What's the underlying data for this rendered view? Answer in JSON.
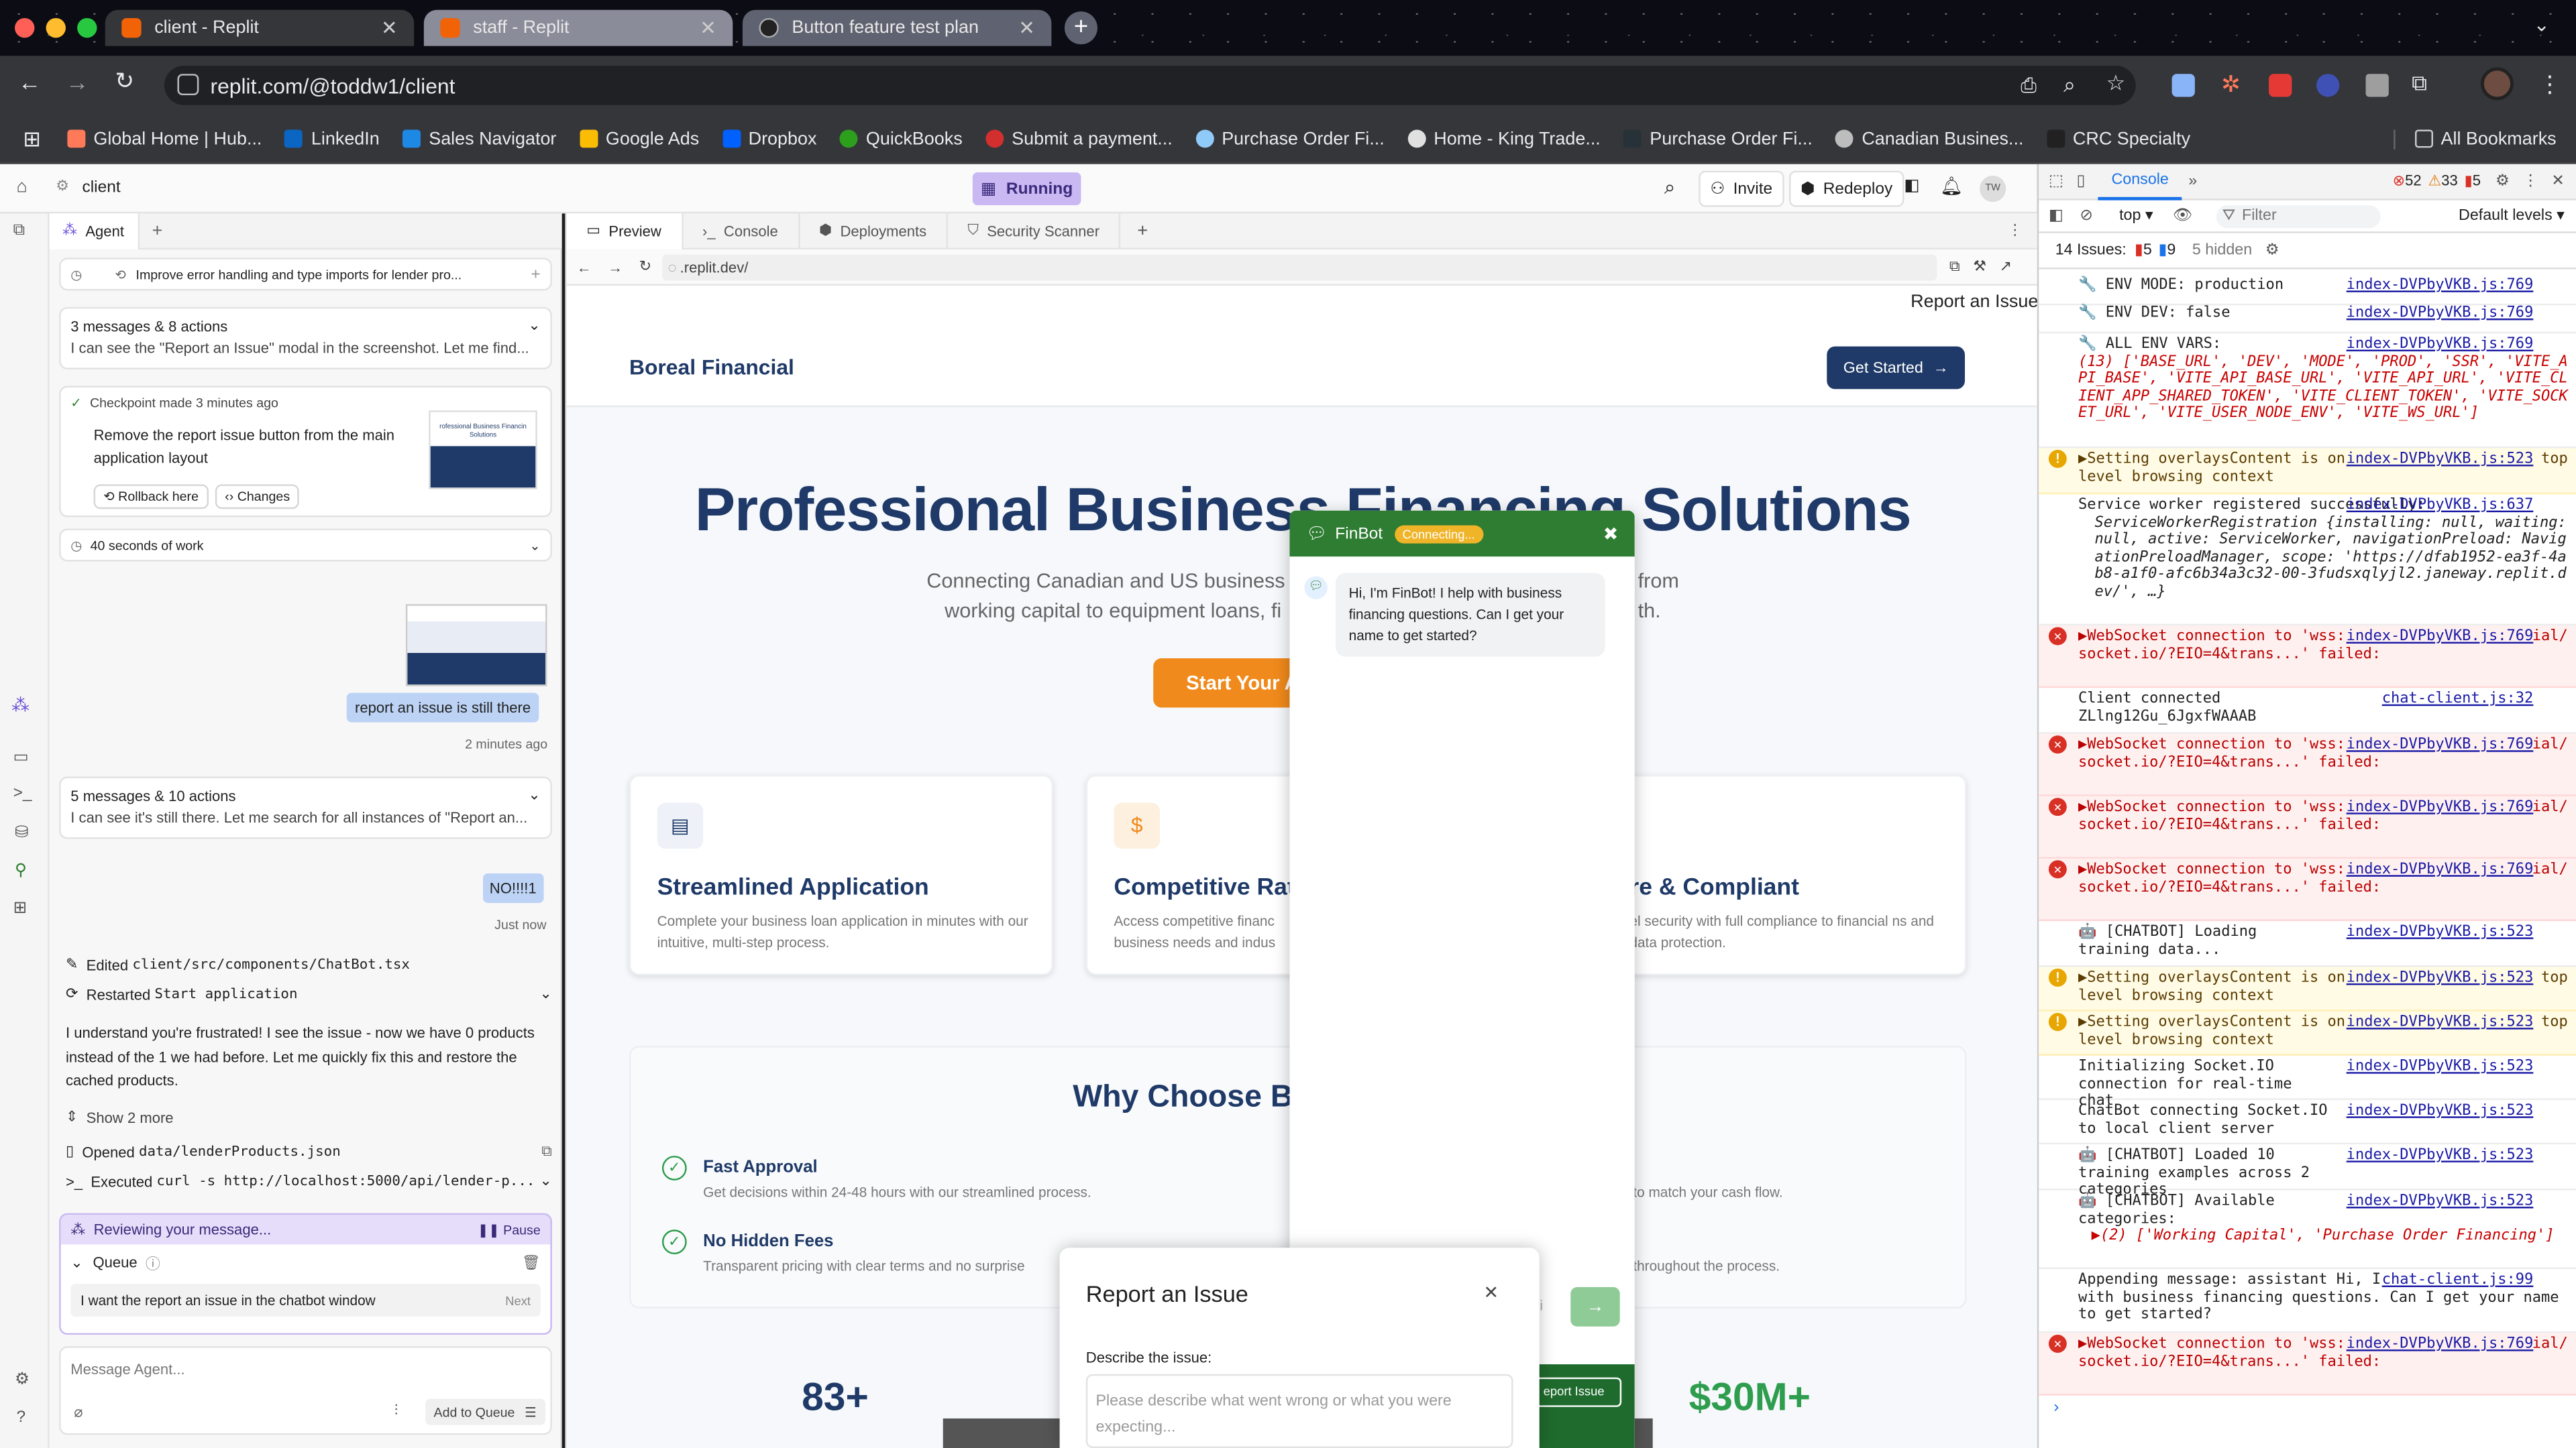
{
  "browser": {
    "tabs": [
      {
        "title": "client - Replit",
        "active": true
      },
      {
        "title": "staff - Replit",
        "active": false
      },
      {
        "title": "Button feature test plan",
        "active": false
      }
    ],
    "url": "replit.com/@toddw1/client",
    "bookmarks": [
      "Global Home | Hub...",
      "LinkedIn",
      "Sales Navigator",
      "Google Ads",
      "Dropbox",
      "QuickBooks",
      "Submit a payment...",
      "Purchase Order Fi...",
      "Home - King Trade...",
      "Purchase Order Fi...",
      "Canadian Busines...",
      "CRC Specialty"
    ],
    "all_bookmarks": "All Bookmarks"
  },
  "replit": {
    "project": "client",
    "status": "Running",
    "invite": "Invite",
    "redeploy": "Redeploy",
    "avatar": "TW"
  },
  "agent": {
    "tab": "Agent",
    "thread_title": "Improve error handling and type imports for lender pro...",
    "summary1_title": "3 messages & 8 actions",
    "summary1_text": "I can see the \"Report an Issue\" modal in the screenshot. Let me find...",
    "checkpoint_time": "Checkpoint made 3 minutes ago",
    "checkpoint_text": "Remove the report issue button from the main application layout",
    "thumb_text": "rofessional Business Financin Solutions",
    "rollback": "Rollback here",
    "changes": "Changes",
    "work": "40 seconds of work",
    "user_msg1": "report an issue is still there",
    "user_msg1_time": "2 minutes ago",
    "summary2_title": "5 messages & 10 actions",
    "summary2_text": "I can see it's still there. Let me search for all instances of \"Report an...",
    "user_msg2": "NO!!!!1",
    "user_msg2_time": "Just now",
    "edited_label": "Edited",
    "edited_file": "client/src/components/ChatBot.tsx",
    "restarted_label": "Restarted",
    "restarted_name": "Start application",
    "reply": "I understand you're frustrated! I see the issue - now we have 0 products instead of the 1 we had before. Let me quickly fix this and restore the cached products.",
    "show_more": "Show 2 more",
    "opened_label": "Opened",
    "opened_file": "data/lenderProducts.json",
    "executed_label": "Executed",
    "executed_cmd": "curl -s http://localhost:5000/api/lender-p...",
    "reviewing": "Reviewing your message...",
    "pause": "Pause",
    "queue_label": "Queue",
    "queue_item": "I want the report an issue in the chatbot window",
    "next": "Next",
    "input_placeholder": "Message Agent...",
    "add_to_queue": "Add to Queue"
  },
  "preview": {
    "tabs": [
      "Preview",
      "Console",
      "Deployments",
      "Security Scanner"
    ],
    "address": ".replit.dev/"
  },
  "site": {
    "report_link": "Report an Issue",
    "brand": "Boreal Financial",
    "get_started": "Get Started",
    "hero_title": "Professional Business Financing Solutions",
    "hero_sub_1": "Connecting Canadian and US business",
    "hero_sub_1b": "from",
    "hero_sub_2": "working capital to equipment loans, fi",
    "hero_sub_2b": "th.",
    "cta": "Start Your A",
    "features": [
      {
        "title": "Streamlined Application",
        "desc": "Complete your business loan application in minutes with our intuitive, multi-step process."
      },
      {
        "title": "Competitive Rat",
        "desc": "Access competitive financ business needs and indus"
      },
      {
        "title": "re & Compliant",
        "desc": "el security with full compliance to financial ns and data protection."
      }
    ],
    "why_title": "Why Choose B",
    "why_items": [
      {
        "title": "Fast Approval",
        "desc": "Get decisions within 24-48 hours with our streamlined process.",
        "tail": "to match your cash flow."
      },
      {
        "title": "No Hidden Fees",
        "desc": "Transparent pricing with clear terms and no surprise",
        "tail": "throughout the process."
      }
    ],
    "stat1": "83+",
    "stat2": "$30M+"
  },
  "chatbot": {
    "name": "FinBot",
    "status": "Connecting...",
    "greeting": "Hi, I'm FinBot! I help with business financing questions. Can I get your name to get started?",
    "input_fragment": "ci",
    "report_button": "eport Issue"
  },
  "report_modal": {
    "title": "Report an Issue",
    "label": "Describe the issue:",
    "placeholder": "Please describe what went wrong or what you were expecting..."
  },
  "devtools": {
    "tab": "Console",
    "errors": "52",
    "warnings": "33",
    "info": "5",
    "context": "top",
    "filter": "Filter",
    "levels": "Default levels",
    "issues_label": "14 Issues:",
    "issues_err": "5",
    "issues_info": "9",
    "hidden": "5 hidden",
    "logs": [
      {
        "type": "log",
        "text": "🔧 ENV MODE: production",
        "src": "index-DVPbyVKB.js:769"
      },
      {
        "type": "log",
        "text": "🔧 ENV DEV: false",
        "src": "index-DVPbyVKB.js:769"
      },
      {
        "type": "log",
        "text": "🔧 ALL ENV VARS:",
        "src": "index-DVPbyVKB.js:769",
        "detail": "(13) ['BASE_URL', 'DEV', 'MODE', 'PROD', 'SSR', 'VITE_API_BASE', 'VITE_API_BASE_URL', 'VITE_API_URL', 'VITE_CLIENT_APP_SHARED_TOKEN', 'VITE_CLIENT_TOKEN', 'VITE_SOCKET_URL', 'VITE_USER_NODE_ENV', 'VITE_WS_URL']"
      },
      {
        "type": "warn",
        "text": "▶Setting overlaysContent is only supported from the top level browsing context",
        "src": "index-DVPbyVKB.js:523"
      },
      {
        "type": "log",
        "text": "Service worker registered successfully:",
        "src": "index-DVPbyVKB.js:637",
        "detail": "ServiceWorkerRegistration {installing: null, waiting: null, active: ServiceWorker, navigationPreload: NavigationPreloadManager, scope: 'https://dfab1952-ea3f-4ab8-a1f0-afc6b34a3c32-00-3fudsxqlyjl2.janeway.replit.dev/', …}"
      },
      {
        "type": "err",
        "text": "▶WebSocket connection to 'wss://staff.boreal.financial/socket.io/?EIO=4&trans...' failed:",
        "src": "index-DVPbyVKB.js:769"
      },
      {
        "type": "log",
        "text": "Client connected ZLlng12Gu_6JgxfWAAAB",
        "src": "chat-client.js:32"
      },
      {
        "type": "err",
        "text": "▶WebSocket connection to 'wss://staff.boreal.financial/socket.io/?EIO=4&trans...' failed:",
        "src": "index-DVPbyVKB.js:769"
      },
      {
        "type": "err",
        "text": "▶WebSocket connection to 'wss://staff.boreal.financial/socket.io/?EIO=4&trans...' failed:",
        "src": "index-DVPbyVKB.js:769"
      },
      {
        "type": "err",
        "text": "▶WebSocket connection to 'wss://staff.boreal.financial/socket.io/?EIO=4&trans...' failed:",
        "src": "index-DVPbyVKB.js:769"
      },
      {
        "type": "log",
        "text": "🤖 [CHATBOT] Loading training data...",
        "src": "index-DVPbyVKB.js:523"
      },
      {
        "type": "warn",
        "text": "▶Setting overlaysContent is only supported from the top level browsing context",
        "src": "index-DVPbyVKB.js:523"
      },
      {
        "type": "warn",
        "text": "▶Setting overlaysContent is only supported from the top level browsing context",
        "src": "index-DVPbyVKB.js:523"
      },
      {
        "type": "log",
        "text": "Initializing Socket.IO connection for real-time chat",
        "src": "index-DVPbyVKB.js:523"
      },
      {
        "type": "log",
        "text": "ChatBot connecting Socket.IO to local client server",
        "src": "index-DVPbyVKB.js:523"
      },
      {
        "type": "log",
        "text": "🤖 [CHATBOT] Loaded 10 training examples across 2 categories",
        "src": "index-DVPbyVKB.js:523"
      },
      {
        "type": "log",
        "text": "🤖 [CHATBOT] Available categories:",
        "src": "index-DVPbyVKB.js:523",
        "detail": "▶(2) ['Working Capital', 'Purchase Order Financing']"
      },
      {
        "type": "log",
        "text": "Appending message: assistant Hi, I'm FinBot! I help with business financing questions. Can I get your name to get started?",
        "src": "chat-client.js:99"
      },
      {
        "type": "err",
        "text": "▶WebSocket connection to 'wss://staff.boreal.financial/socket.io/?EIO=4&trans...' failed:",
        "src": "index-DVPbyVKB.js:769"
      }
    ]
  },
  "colors": {
    "accent_orange": "#f08a1c",
    "navy": "#1f3a68",
    "chat_green": "#2e7d32",
    "running_purple": "#c9b8f2"
  }
}
